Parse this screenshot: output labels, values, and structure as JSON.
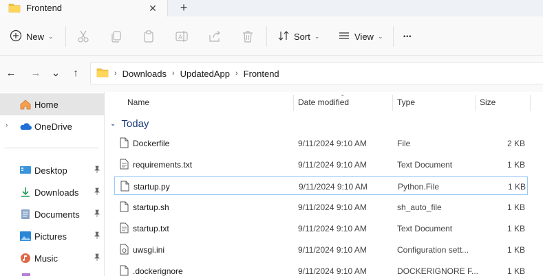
{
  "window": {
    "tab_title": "Frontend",
    "close_glyph": "✕",
    "new_tab_glyph": "+"
  },
  "toolbar": {
    "new_label": "New",
    "sort_label": "Sort",
    "view_label": "View",
    "more_glyph": "•••",
    "icons": [
      "cut-icon",
      "copy-icon",
      "paste-icon",
      "rename-icon",
      "share-icon",
      "delete-icon"
    ]
  },
  "navigation": {
    "back_glyph": "←",
    "forward_glyph": "→",
    "recent_glyph": "⌄",
    "up_glyph": "↑",
    "breadcrumb": [
      "Downloads",
      "UpdatedApp",
      "Frontend"
    ],
    "breadcrumb_sep": "›"
  },
  "sidebar": {
    "home": "Home",
    "onedrive": "OneDrive",
    "pinned": [
      {
        "label": "Desktop",
        "icon": "desktop-icon"
      },
      {
        "label": "Downloads",
        "icon": "downloads-icon"
      },
      {
        "label": "Documents",
        "icon": "documents-icon"
      },
      {
        "label": "Pictures",
        "icon": "pictures-icon"
      },
      {
        "label": "Music",
        "icon": "music-icon"
      }
    ],
    "pin_glyph": "📌"
  },
  "columns": {
    "name": "Name",
    "date": "Date modified",
    "type": "Type",
    "size": "Size"
  },
  "group": {
    "label": "Today"
  },
  "files": [
    {
      "name": "Dockerfile",
      "date": "9/11/2024 9:10 AM",
      "type": "File",
      "size": "2 KB"
    },
    {
      "name": "requirements.txt",
      "date": "9/11/2024 9:10 AM",
      "type": "Text Document",
      "size": "1 KB"
    },
    {
      "name": "startup.py",
      "date": "9/11/2024 9:10 AM",
      "type": "Python.File",
      "size": "1 KB"
    },
    {
      "name": "startup.sh",
      "date": "9/11/2024 9:10 AM",
      "type": "sh_auto_file",
      "size": "1 KB"
    },
    {
      "name": "startup.txt",
      "date": "9/11/2024 9:10 AM",
      "type": "Text Document",
      "size": "1 KB"
    },
    {
      "name": "uwsgi.ini",
      "date": "9/11/2024 9:10 AM",
      "type": "Configuration sett...",
      "size": "1 KB"
    },
    {
      "name": ".dockerignore",
      "date": "9/11/2024 9:10 AM",
      "type": "DOCKERIGNORE F...",
      "size": "1 KB"
    }
  ],
  "colors": {
    "folder": "#f4c542",
    "accent": "#0f6cbd",
    "group_text": "#1c3a78"
  }
}
